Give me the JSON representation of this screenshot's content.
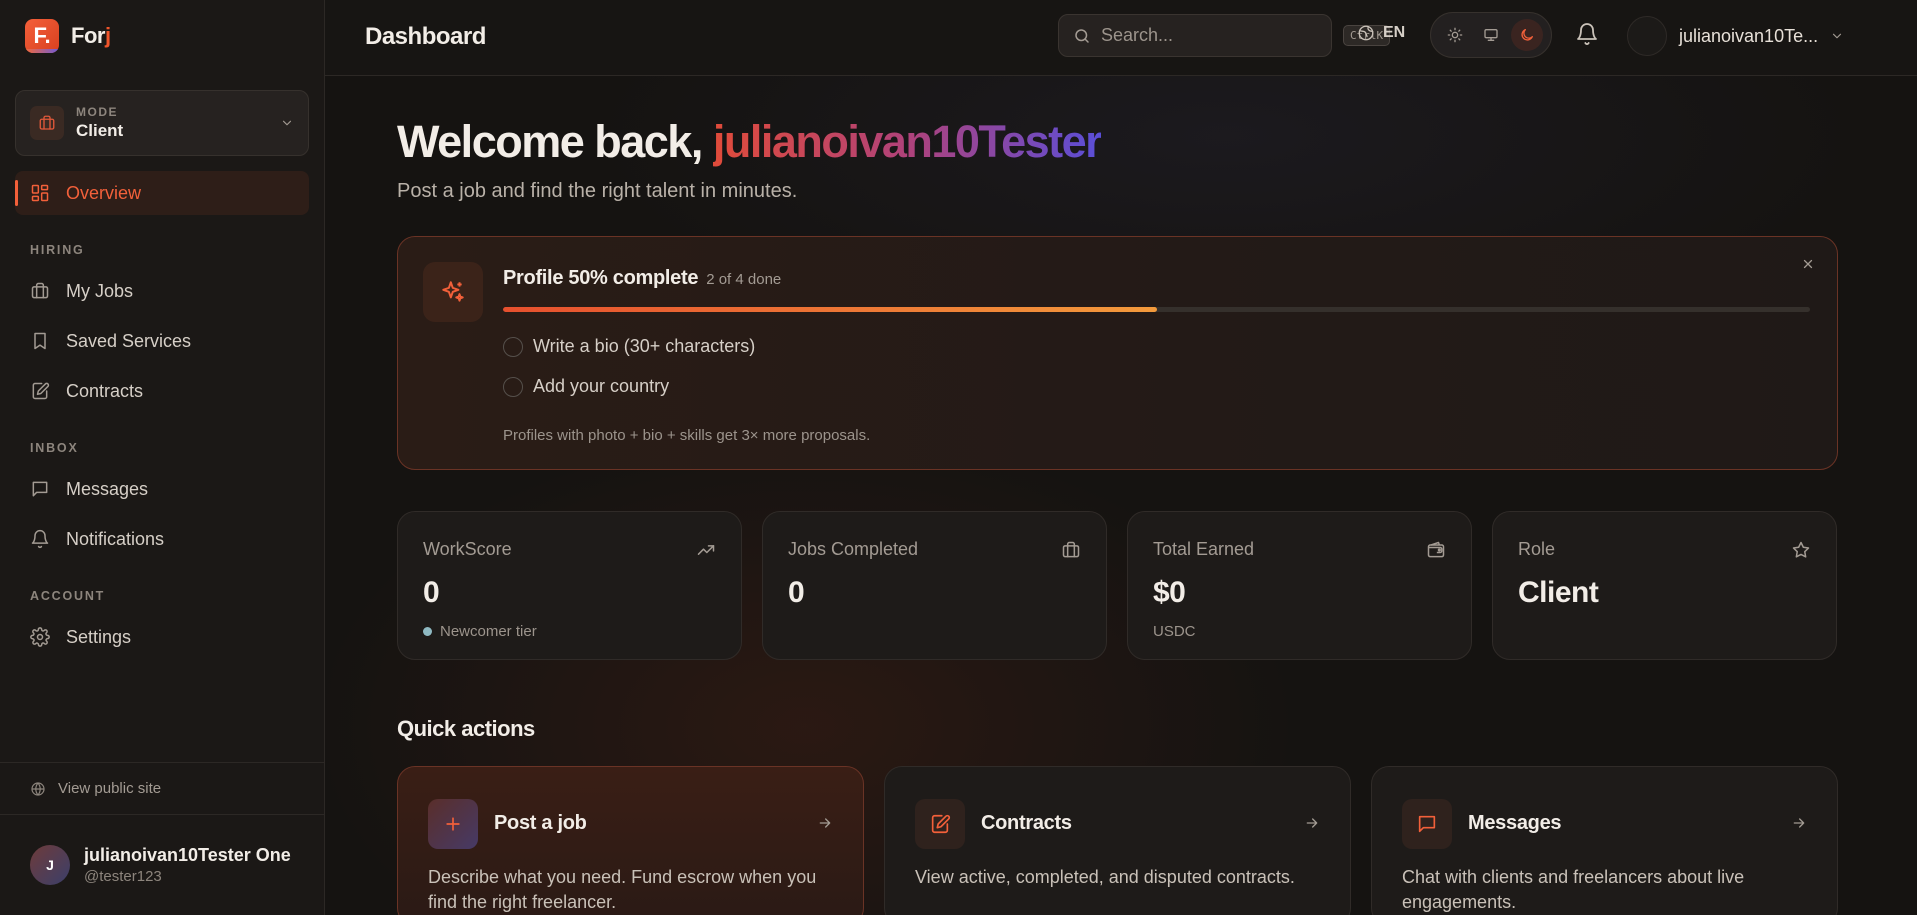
{
  "brand": {
    "letter": "F.",
    "name_main": "For",
    "name_accent": "j"
  },
  "mode": {
    "label": "MODE",
    "value": "Client"
  },
  "nav": {
    "overview": "Overview",
    "sections": {
      "hiring": "HIRING",
      "inbox": "INBOX",
      "account": "ACCOUNT"
    },
    "my_jobs": "My Jobs",
    "saved_services": "Saved Services",
    "contracts": "Contracts",
    "messages": "Messages",
    "notifications": "Notifications",
    "settings": "Settings"
  },
  "footer": {
    "view_public": "View public site",
    "avatar_initial": "J",
    "name": "julianoivan10Tester One",
    "handle": "@tester123"
  },
  "topbar": {
    "title": "Dashboard",
    "search_placeholder": "Search...",
    "search_shortcut": "CtrlK",
    "language": "EN",
    "user_name": "julianoivan10Te..."
  },
  "welcome": {
    "prefix": "Welcome back, ",
    "username": "julianoivan10Tester",
    "subtitle": "Post a job and find the right talent in minutes."
  },
  "profile": {
    "title": "Profile 50% complete",
    "count": "2 of 4 done",
    "progress": 0.5,
    "items": [
      "Write a bio (30+ characters)",
      "Add your country"
    ],
    "hint": "Profiles with photo + bio + skills get 3× more proposals."
  },
  "stats": [
    {
      "label": "WorkScore",
      "value": "0",
      "sub": "Newcomer tier",
      "icon": "trending-up-icon"
    },
    {
      "label": "Jobs Completed",
      "value": "0",
      "sub": "",
      "icon": "briefcase-icon"
    },
    {
      "label": "Total Earned",
      "value": "$0",
      "sub": "USDC",
      "icon": "wallet-icon"
    },
    {
      "label": "Role",
      "value": "Client",
      "sub": "",
      "icon": "star-icon"
    }
  ],
  "quick_actions": {
    "title": "Quick actions",
    "items": [
      {
        "title": "Post a job",
        "desc": "Describe what you need. Fund escrow when you find the right freelancer.",
        "icon": "plus-icon"
      },
      {
        "title": "Contracts",
        "desc": "View active, completed, and disputed contracts.",
        "icon": "edit-document-icon"
      },
      {
        "title": "Messages",
        "desc": "Chat with clients and freelancers about live engagements.",
        "icon": "message-icon"
      }
    ]
  },
  "colors": {
    "accent": "#f2603a",
    "background": "#151311",
    "sidebar": "#1b1816"
  }
}
